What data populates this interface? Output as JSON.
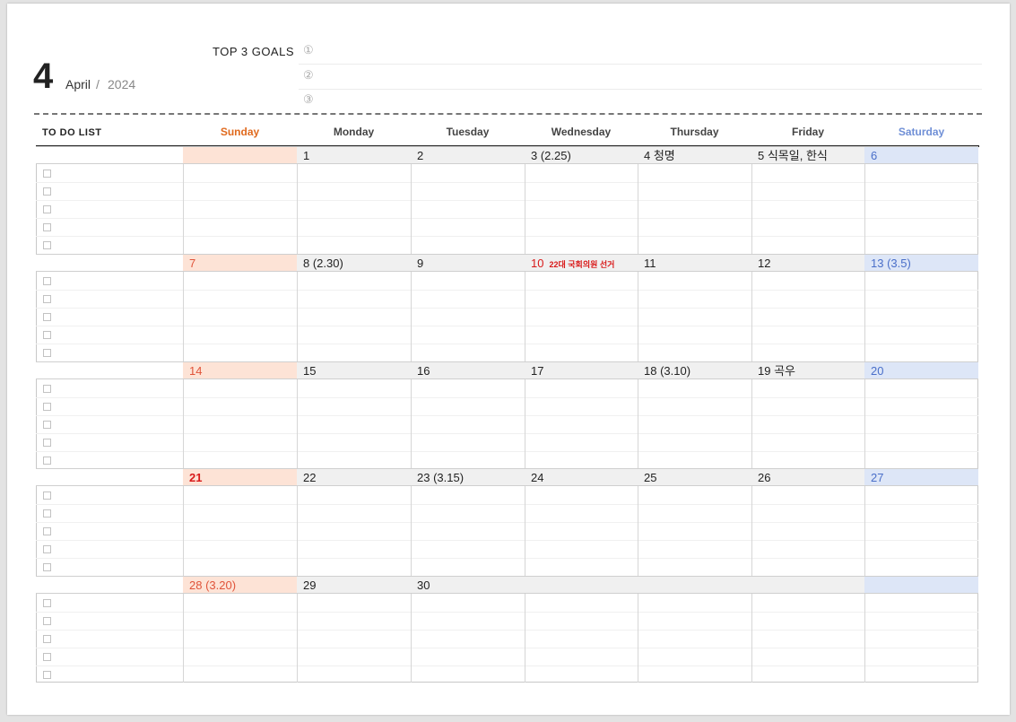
{
  "header": {
    "month_number": "4",
    "month_name": "April",
    "separator": "/",
    "year": "2024",
    "goals_label": "TOP 3 GOALS",
    "goals": [
      "①",
      "②",
      "③"
    ]
  },
  "todo_label": "TO DO LIST",
  "weekdays": [
    "Sunday",
    "Monday",
    "Tuesday",
    "Wednesday",
    "Thursday",
    "Friday",
    "Saturday"
  ],
  "colors": {
    "sunday_header": "#e06a1e",
    "saturday_header": "#6f8fd6",
    "sunday_fill": "#fde3d6",
    "saturday_fill": "#dde6f7",
    "weekday_fill": "#f0f0f0",
    "holiday_red": "#d91a1a",
    "sunday_text": "#e0543a",
    "saturday_text": "#4a6fc9"
  },
  "weeks": [
    [
      {
        "label": ""
      },
      {
        "label": "1"
      },
      {
        "label": "2"
      },
      {
        "label": "3  (2.25)"
      },
      {
        "label": "4  청명"
      },
      {
        "label": "5  식목일, 한식"
      },
      {
        "label": "6"
      }
    ],
    [
      {
        "label": "7"
      },
      {
        "label": "8  (2.30)"
      },
      {
        "label": "9"
      },
      {
        "label": "10",
        "note": "22대 국회의원 선거",
        "holiday": true
      },
      {
        "label": "11"
      },
      {
        "label": "12"
      },
      {
        "label": "13  (3.5)"
      }
    ],
    [
      {
        "label": "14"
      },
      {
        "label": "15"
      },
      {
        "label": "16"
      },
      {
        "label": "17"
      },
      {
        "label": "18  (3.10)"
      },
      {
        "label": "19  곡우"
      },
      {
        "label": "20"
      }
    ],
    [
      {
        "label": "21",
        "bold": true
      },
      {
        "label": "22"
      },
      {
        "label": "23  (3.15)"
      },
      {
        "label": "24"
      },
      {
        "label": "25"
      },
      {
        "label": "26"
      },
      {
        "label": "27"
      }
    ],
    [
      {
        "label": "28  (3.20)"
      },
      {
        "label": "29"
      },
      {
        "label": "30"
      },
      {
        "label": ""
      },
      {
        "label": ""
      },
      {
        "label": ""
      },
      {
        "label": ""
      }
    ]
  ]
}
